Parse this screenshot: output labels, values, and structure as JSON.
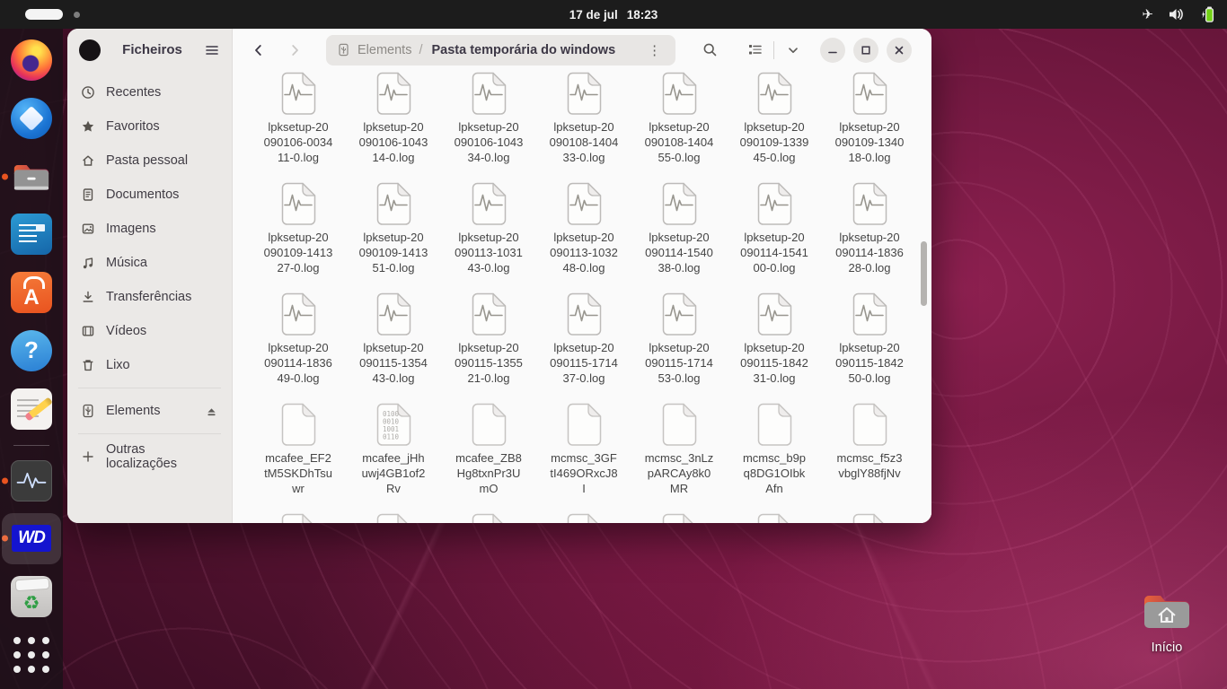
{
  "topbar": {
    "date": "17 de jul",
    "time": "18:23",
    "status_icons": [
      "airplane-mode-icon",
      "volume-icon",
      "battery-charging-icon"
    ]
  },
  "dock": {
    "items": [
      {
        "name": "firefox",
        "running": false,
        "active": false
      },
      {
        "name": "thunderbird",
        "running": false,
        "active": false
      },
      {
        "name": "files",
        "running": true,
        "active": false
      },
      {
        "name": "libreoffice-writer",
        "running": false,
        "active": false
      },
      {
        "name": "app-center",
        "running": false,
        "active": false
      },
      {
        "name": "help",
        "running": false,
        "active": false
      },
      {
        "name": "text-editor",
        "running": false,
        "active": false
      },
      {
        "name": "system-monitor",
        "running": true,
        "active": false
      },
      {
        "name": "wd-software",
        "running": true,
        "active": true
      },
      {
        "name": "trash",
        "running": false,
        "active": false
      },
      {
        "name": "app-grid",
        "running": false,
        "active": false
      }
    ]
  },
  "window": {
    "app_title": "Ficheiros",
    "sidebar": {
      "items": [
        {
          "icon": "recents-icon",
          "label": "Recentes"
        },
        {
          "icon": "star-icon",
          "label": "Favoritos"
        },
        {
          "icon": "home-icon",
          "label": "Pasta pessoal"
        },
        {
          "icon": "document-icon",
          "label": "Documentos"
        },
        {
          "icon": "image-icon",
          "label": "Imagens"
        },
        {
          "icon": "music-icon",
          "label": "Música"
        },
        {
          "icon": "download-icon",
          "label": "Transferências"
        },
        {
          "icon": "film-icon",
          "label": "Vídeos"
        },
        {
          "icon": "trash-icon",
          "label": "Lixo"
        }
      ],
      "device": {
        "icon": "usb-drive-icon",
        "label": "Elements"
      },
      "other_locations_label": "Outras localizações"
    },
    "header": {
      "breadcrumb": {
        "device": "Elements",
        "separator": "/",
        "folder": "Pasta temporária do windows"
      }
    },
    "icons": {
      "binary_rows": [
        "0100",
        "0010",
        "1001",
        "0110"
      ]
    },
    "files": [
      {
        "label": "lpksetup-20\n090106-0034\n11-0.log",
        "icon": "log"
      },
      {
        "label": "lpksetup-20\n090106-1043\n14-0.log",
        "icon": "log"
      },
      {
        "label": "lpksetup-20\n090106-1043\n34-0.log",
        "icon": "log"
      },
      {
        "label": "lpksetup-20\n090108-1404\n33-0.log",
        "icon": "log"
      },
      {
        "label": "lpksetup-20\n090108-1404\n55-0.log",
        "icon": "log"
      },
      {
        "label": "lpksetup-20\n090109-1339\n45-0.log",
        "icon": "log"
      },
      {
        "label": "lpksetup-20\n090109-1340\n18-0.log",
        "icon": "log"
      },
      {
        "label": "lpksetup-20\n090109-1413\n27-0.log",
        "icon": "log"
      },
      {
        "label": "lpksetup-20\n090109-1413\n51-0.log",
        "icon": "log"
      },
      {
        "label": "lpksetup-20\n090113-1031\n43-0.log",
        "icon": "log"
      },
      {
        "label": "lpksetup-20\n090113-1032\n48-0.log",
        "icon": "log"
      },
      {
        "label": "lpksetup-20\n090114-1540\n38-0.log",
        "icon": "log"
      },
      {
        "label": "lpksetup-20\n090114-1541\n00-0.log",
        "icon": "log"
      },
      {
        "label": "lpksetup-20\n090114-1836\n28-0.log",
        "icon": "log"
      },
      {
        "label": "lpksetup-20\n090114-1836\n49-0.log",
        "icon": "log"
      },
      {
        "label": "lpksetup-20\n090115-1354\n43-0.log",
        "icon": "log"
      },
      {
        "label": "lpksetup-20\n090115-1355\n21-0.log",
        "icon": "log"
      },
      {
        "label": "lpksetup-20\n090115-1714\n37-0.log",
        "icon": "log"
      },
      {
        "label": "lpksetup-20\n090115-1714\n53-0.log",
        "icon": "log"
      },
      {
        "label": "lpksetup-20\n090115-1842\n31-0.log",
        "icon": "log"
      },
      {
        "label": "lpksetup-20\n090115-1842\n50-0.log",
        "icon": "log"
      },
      {
        "label": "mcafee_EF2\ntM5SKDhTsu\nwr",
        "icon": "plain"
      },
      {
        "label": "mcafee_jHh\nuwj4GB1of2\nRv",
        "icon": "binary"
      },
      {
        "label": "mcafee_ZB8\nHg8txnPr3U\nmO",
        "icon": "plain"
      },
      {
        "label": "mcmsc_3GF\ntI469ORxcJ8\nI",
        "icon": "plain"
      },
      {
        "label": "mcmsc_3nLz\npARCAy8k0\nMR",
        "icon": "plain"
      },
      {
        "label": "mcmsc_b9p\nq8DG1OIbk\nAfn",
        "icon": "plain"
      },
      {
        "label": "mcmsc_f5z3\nvbglY88fjNv",
        "icon": "plain"
      },
      {
        "label": "",
        "icon": "plain"
      },
      {
        "label": "",
        "icon": "plain"
      },
      {
        "label": "",
        "icon": "plain"
      },
      {
        "label": "",
        "icon": "plain"
      },
      {
        "label": "",
        "icon": "plain"
      },
      {
        "label": "",
        "icon": "plain"
      },
      {
        "label": "",
        "icon": "plain"
      }
    ]
  },
  "desktop": {
    "home_label": "Início"
  }
}
